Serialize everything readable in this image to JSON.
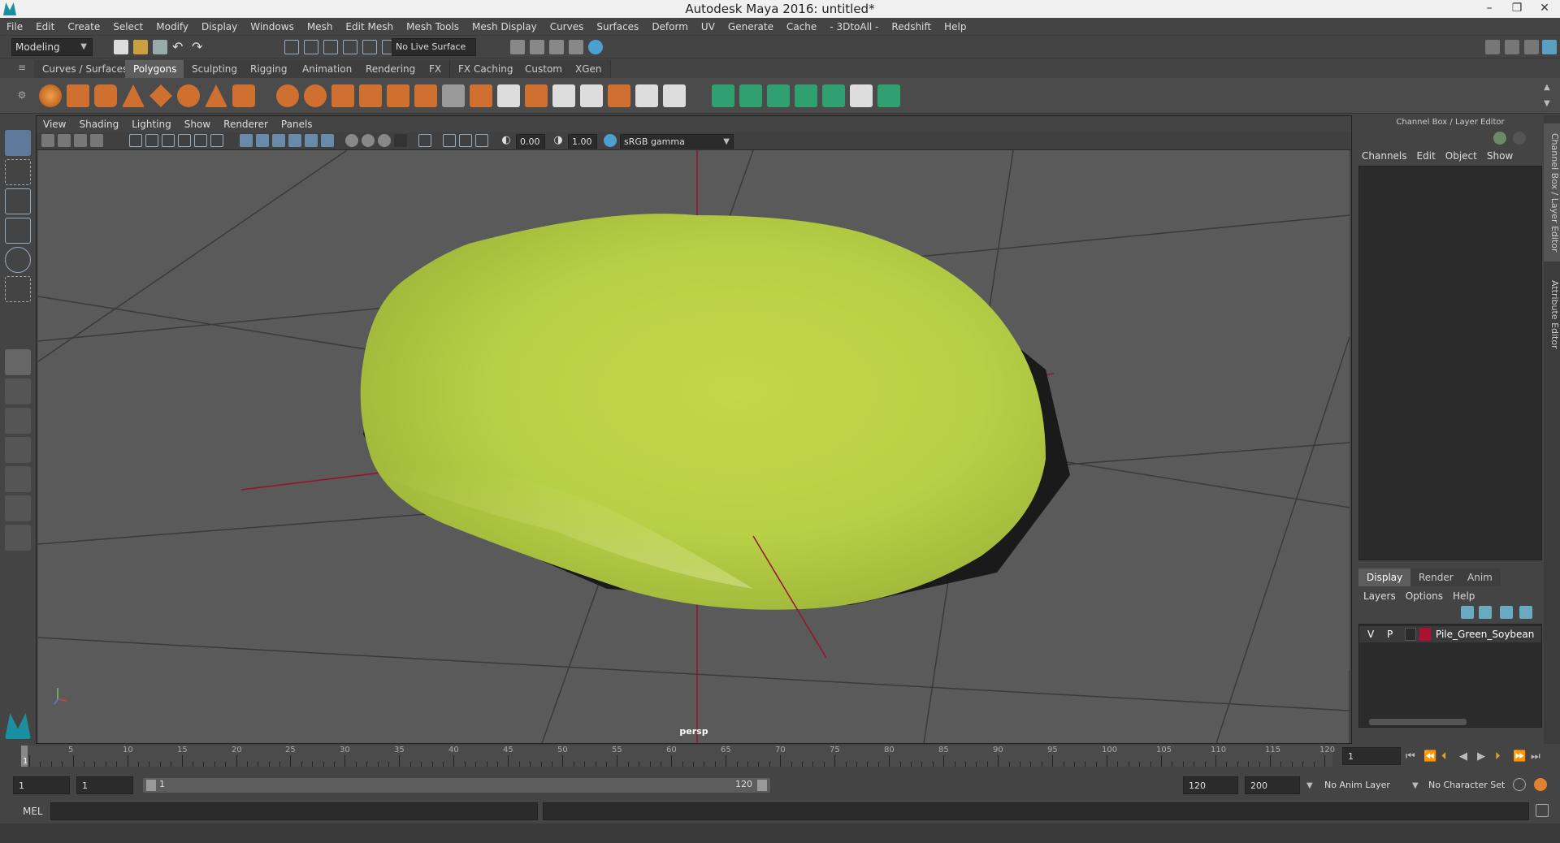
{
  "window": {
    "title": "Autodesk Maya 2016: untitled*",
    "min": "–",
    "restore": "❐",
    "close": "✕"
  },
  "menubar": [
    "File",
    "Edit",
    "Create",
    "Select",
    "Modify",
    "Display",
    "Windows",
    "Mesh",
    "Edit Mesh",
    "Mesh Tools",
    "Mesh Display",
    "Curves",
    "Surfaces",
    "Deform",
    "UV",
    "Generate",
    "Cache",
    "- 3DtoAll -",
    "Redshift",
    "Help"
  ],
  "status": {
    "mode": "Modeling",
    "live_surface": "No Live Surface"
  },
  "shelf_tabs": [
    {
      "label": "Curves / Surfaces",
      "active": false
    },
    {
      "label": "Polygons",
      "active": true
    },
    {
      "label": "Sculpting",
      "active": false
    },
    {
      "label": "Rigging",
      "active": false
    },
    {
      "label": "Animation",
      "active": false
    },
    {
      "label": "Rendering",
      "active": false
    },
    {
      "label": "FX",
      "active": false
    },
    {
      "label": "FX Caching",
      "active": false
    },
    {
      "label": "Custom",
      "active": false
    },
    {
      "label": "XGen",
      "active": false
    }
  ],
  "viewport": {
    "menu": [
      "View",
      "Shading",
      "Lighting",
      "Show",
      "Renderer",
      "Panels"
    ],
    "exposure": "0.00",
    "gamma": "1.00",
    "colorspace": "sRGB gamma",
    "camera": "persp"
  },
  "channel_box": {
    "header": "Channel Box / Layer Editor",
    "menu": [
      "Channels",
      "Edit",
      "Object",
      "Show"
    ],
    "layer_tabs": [
      {
        "label": "Display",
        "active": true
      },
      {
        "label": "Render",
        "active": false
      },
      {
        "label": "Anim",
        "active": false
      }
    ],
    "layer_menu": [
      "Layers",
      "Options",
      "Help"
    ],
    "layer": {
      "v": "V",
      "p": "P",
      "name": "Pile_Green_Soybean",
      "color": "#b01030"
    }
  },
  "side_tabs": [
    "Channel Box / Layer Editor",
    "Attribute Editor"
  ],
  "timeline": {
    "labels": [
      "1",
      "5",
      "10",
      "15",
      "20",
      "25",
      "30",
      "35",
      "40",
      "45",
      "50",
      "55",
      "60",
      "65",
      "70",
      "75",
      "80",
      "85",
      "90",
      "95",
      "100",
      "105",
      "110",
      "115",
      "120"
    ],
    "current": "1"
  },
  "range": {
    "start": "1",
    "current": "1",
    "slider_start": "1",
    "slider_end": "120",
    "end": "120",
    "max": "200",
    "anim_layer": "No Anim Layer",
    "char_set": "No Character Set"
  },
  "command": {
    "lang": "MEL"
  },
  "colors": {
    "object": "#bcd24a",
    "axis": "#9b1030",
    "accent": "#5d5d5d"
  }
}
